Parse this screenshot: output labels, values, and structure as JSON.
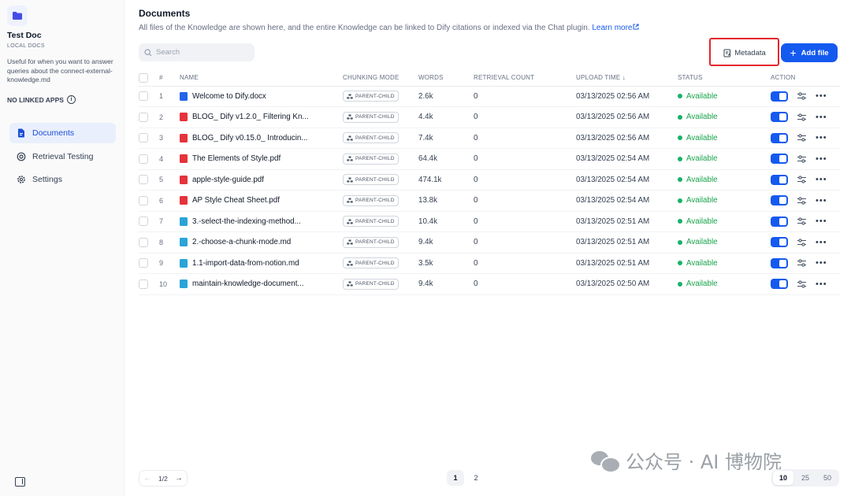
{
  "sidebar": {
    "kb_name": "Test Doc",
    "kb_type": "LOCAL DOCS",
    "kb_description": "Useful for when you want to answer queries about the connect-external-knowledge.md",
    "linked_apps": "NO LINKED APPS",
    "nav": [
      {
        "label": "Documents",
        "icon": "document-icon",
        "active": true
      },
      {
        "label": "Retrieval Testing",
        "icon": "target-icon",
        "active": false
      },
      {
        "label": "Settings",
        "icon": "gear-icon",
        "active": false
      }
    ]
  },
  "header": {
    "title": "Documents",
    "subtitle": "All files of the Knowledge are shown here, and the entire Knowledge can be linked to Dify citations or indexed via the Chat plugin.",
    "learn_more": "Learn more"
  },
  "toolbar": {
    "search_placeholder": "Search",
    "metadata_label": "Metadata",
    "add_file_label": "Add file",
    "accent_color": "#155aef",
    "highlight_color": "#e4272d"
  },
  "table": {
    "columns": [
      "#",
      "NAME",
      "CHUNKING MODE",
      "WORDS",
      "RETRIEVAL COUNT",
      "UPLOAD TIME ↓",
      "STATUS",
      "ACTION"
    ],
    "rows": [
      {
        "index": "1",
        "name": "Welcome to Dify.docx",
        "type": "docx",
        "mode": "PARENT-CHILD",
        "words": "2.6k",
        "retrieval": "0",
        "time": "03/13/2025 02:56 AM",
        "status": "Available"
      },
      {
        "index": "2",
        "name": "BLOG_ Dify v1.2.0_ Filtering Kn...",
        "type": "pdf",
        "mode": "PARENT-CHILD",
        "words": "4.4k",
        "retrieval": "0",
        "time": "03/13/2025 02:56 AM",
        "status": "Available"
      },
      {
        "index": "3",
        "name": "BLOG_ Dify v0.15.0_ Introducin...",
        "type": "pdf",
        "mode": "PARENT-CHILD",
        "words": "7.4k",
        "retrieval": "0",
        "time": "03/13/2025 02:56 AM",
        "status": "Available"
      },
      {
        "index": "4",
        "name": "The Elements of Style.pdf",
        "type": "pdf",
        "mode": "PARENT-CHILD",
        "words": "64.4k",
        "retrieval": "0",
        "time": "03/13/2025 02:54 AM",
        "status": "Available"
      },
      {
        "index": "5",
        "name": "apple-style-guide.pdf",
        "type": "pdf",
        "mode": "PARENT-CHILD",
        "words": "474.1k",
        "retrieval": "0",
        "time": "03/13/2025 02:54 AM",
        "status": "Available"
      },
      {
        "index": "6",
        "name": "AP Style Cheat Sheet.pdf",
        "type": "pdf",
        "mode": "PARENT-CHILD",
        "words": "13.8k",
        "retrieval": "0",
        "time": "03/13/2025 02:54 AM",
        "status": "Available"
      },
      {
        "index": "7",
        "name": "3.-select-the-indexing-method...",
        "type": "md",
        "mode": "PARENT-CHILD",
        "words": "10.4k",
        "retrieval": "0",
        "time": "03/13/2025 02:51 AM",
        "status": "Available"
      },
      {
        "index": "8",
        "name": "2.-choose-a-chunk-mode.md",
        "type": "md",
        "mode": "PARENT-CHILD",
        "words": "9.4k",
        "retrieval": "0",
        "time": "03/13/2025 02:51 AM",
        "status": "Available"
      },
      {
        "index": "9",
        "name": "1.1-import-data-from-notion.md",
        "type": "md",
        "mode": "PARENT-CHILD",
        "words": "3.5k",
        "retrieval": "0",
        "time": "03/13/2025 02:51 AM",
        "status": "Available"
      },
      {
        "index": "10",
        "name": "maintain-knowledge-document...",
        "type": "md",
        "mode": "PARENT-CHILD",
        "words": "9.4k",
        "retrieval": "0",
        "time": "03/13/2025 02:50 AM",
        "status": "Available"
      }
    ]
  },
  "pagination": {
    "current": "1/2",
    "pages": [
      "1",
      "2"
    ],
    "sizes": [
      "10",
      "25",
      "50"
    ]
  },
  "watermark": "公众号 · AI 博物院"
}
